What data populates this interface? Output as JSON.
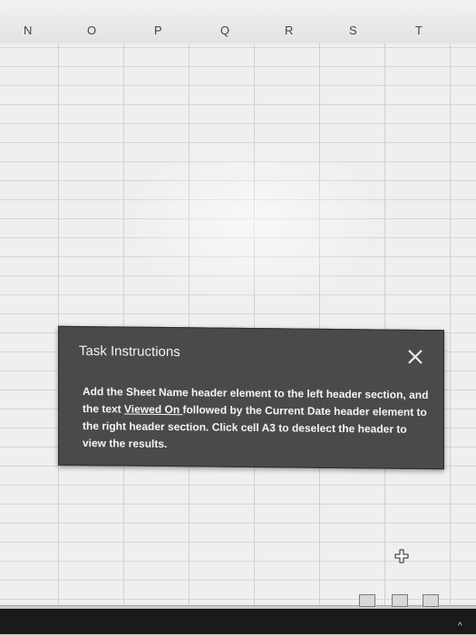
{
  "columns": [
    "N",
    "O",
    "P",
    "Q",
    "R",
    "S",
    "T"
  ],
  "dialog": {
    "title": "Task Instructions",
    "body_part1": "Add the Sheet Name header element to the left header section, and the text ",
    "body_underlined": "Viewed On ",
    "body_part2": " followed by the Current Date header element to the right header section. Click cell A3 to deselect the header to view the results."
  },
  "icons": {
    "close": "close-icon",
    "cursor": "cross-cursor-icon",
    "views": [
      "normal-view-icon",
      "page-layout-view-icon",
      "page-break-view-icon"
    ]
  }
}
